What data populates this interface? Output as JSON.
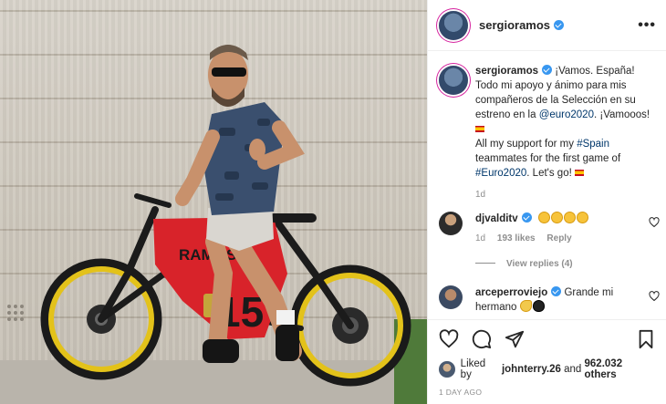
{
  "post": {
    "username": "sergioramos",
    "more_label": "•••",
    "caption": {
      "username": "sergioramos",
      "line_es_1": "¡Vamos. España! Todo mi apoyo y ánimo para mis compañeros de la Selección en su estreno en la ",
      "mention": "@euro2020",
      "line_es_2": ". ¡Vamooos!",
      "line_en_1": "All my support for my ",
      "hashtag_spain": "#Spain",
      "line_en_2": " teammates for the first game of ",
      "hashtag_euro": "#Euro2020",
      "line_en_3": ". Let's go!",
      "time": "1d"
    },
    "comments": [
      {
        "username": "djvalditv",
        "emoji_count": 4,
        "time": "1d",
        "likes": "193 likes",
        "reply": "Reply",
        "view_replies": "View replies (4)"
      },
      {
        "username": "arceperroviejo",
        "text": "Grande mi hermano"
      }
    ],
    "liked_by": {
      "prefix": "Liked by ",
      "user": "johnterry.26",
      "middle": " and ",
      "others": "962.032 others"
    },
    "timestamp": "1 DAY AGO"
  },
  "photo": {
    "bike_brand_text": "RAMOS",
    "bike_number": "15"
  },
  "icons": [
    "heart-icon",
    "comment-icon",
    "share-icon",
    "bookmark-icon",
    "more-options-icon",
    "verified-icon"
  ],
  "colors": {
    "verified": "#3897f0",
    "link": "#00376b",
    "bike_red": "#d8232a",
    "rim_yellow": "#e3c21a"
  }
}
